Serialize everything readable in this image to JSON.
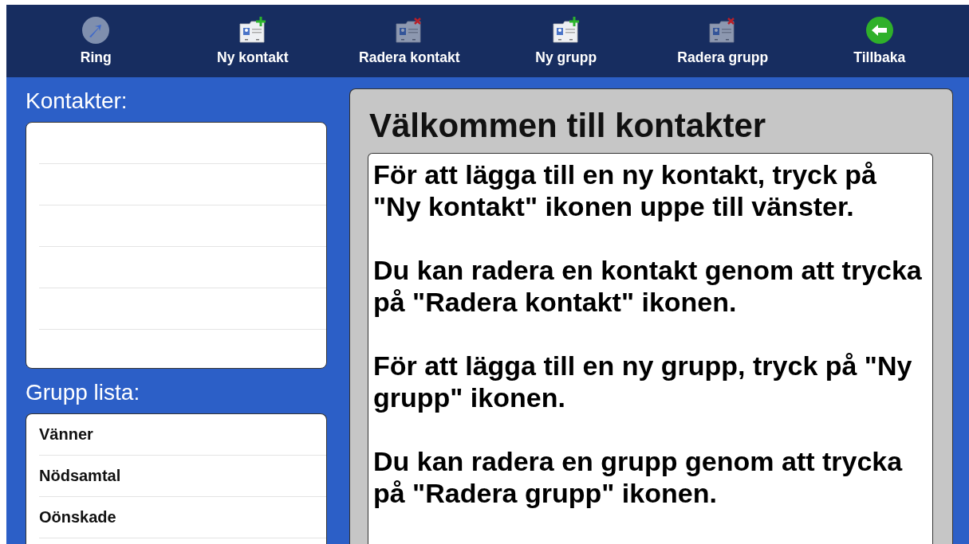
{
  "toolbar": [
    {
      "label": "Ring",
      "kind": "call",
      "disabled": true
    },
    {
      "label": "Ny kontakt",
      "kind": "add",
      "disabled": false
    },
    {
      "label": "Radera kontakt",
      "kind": "delete",
      "disabled": true
    },
    {
      "label": "Ny grupp",
      "kind": "add",
      "disabled": false
    },
    {
      "label": "Radera grupp",
      "kind": "delete",
      "disabled": true
    },
    {
      "label": "Tillbaka",
      "kind": "back",
      "disabled": false
    }
  ],
  "contacts": {
    "title": "Kontakter:"
  },
  "groups": {
    "title": "Grupp lista:",
    "items": [
      "Vänner",
      "Nödsamtal",
      "Oönskade"
    ]
  },
  "welcome": {
    "title": "Välkommen till kontakter",
    "paragraphs": [
      "För att lägga till en ny kontakt, tryck på \"Ny kontakt\" ikonen uppe till vänster.",
      "Du kan radera en kontakt genom att trycka på \"Radera kontakt\" ikonen.",
      "För att lägga till en ny grupp, tryck på \"Ny grupp\" ikonen.",
      "Du kan radera en grupp genom att trycka på \"Radera grupp\" ikonen."
    ]
  }
}
